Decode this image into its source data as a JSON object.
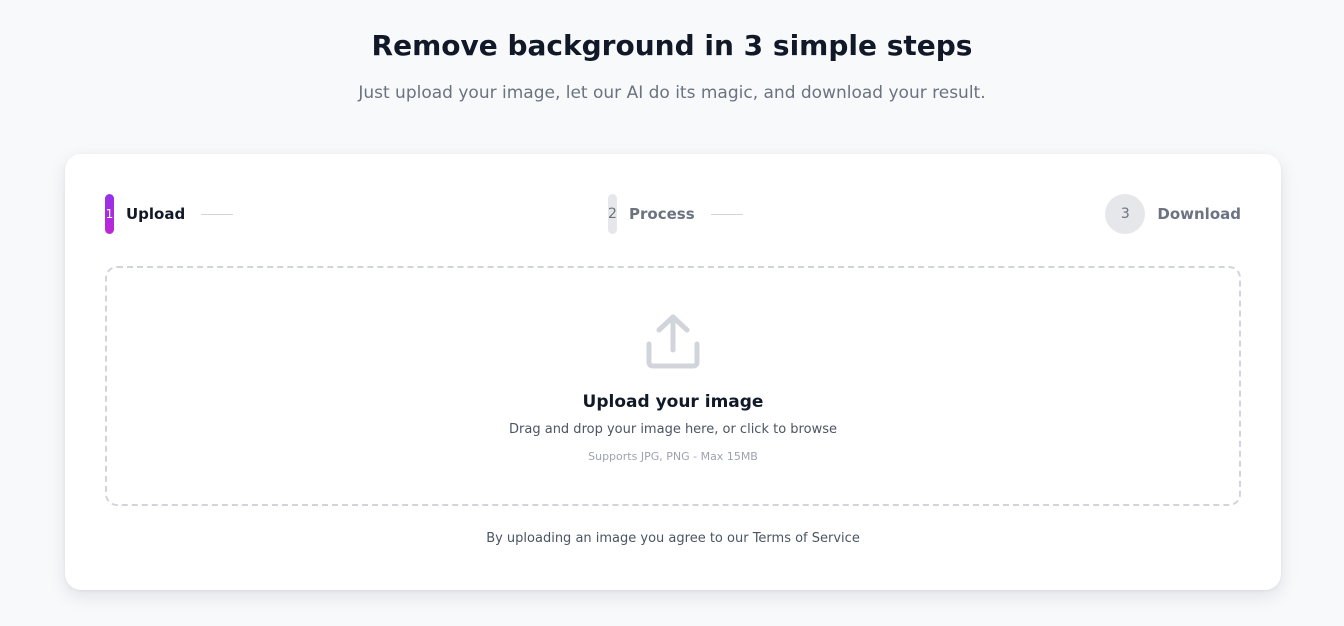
{
  "hero": {
    "title": "Remove background in 3 simple steps",
    "subtitle": "Just upload your image, let our AI do its magic, and download your result."
  },
  "steps": [
    {
      "number": "1",
      "label": "Upload",
      "state": "active"
    },
    {
      "number": "2",
      "label": "Process",
      "state": "inactive"
    },
    {
      "number": "3",
      "label": "Download",
      "state": "inactive"
    }
  ],
  "dropzone": {
    "icon": "upload-icon",
    "title": "Upload your image",
    "description": "Drag and drop your image here, or click to browse",
    "hint": "Supports JPG, PNG - Max 15MB"
  },
  "terms": {
    "prefix": "By uploading an image you agree to our ",
    "link_label": "Terms of Service"
  },
  "colors": {
    "accent_start": "#9333ea",
    "accent_end": "#c026d3",
    "background": "#f8f9fb",
    "card": "#ffffff"
  }
}
